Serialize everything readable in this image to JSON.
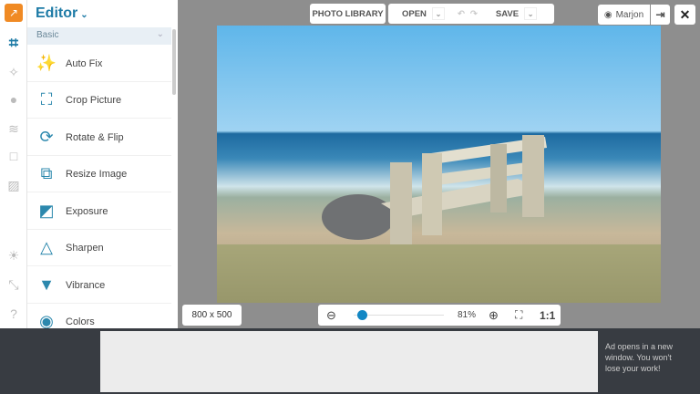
{
  "editor": {
    "title": "Editor",
    "section": "Basic",
    "items": [
      {
        "label": "Auto Fix",
        "icon": "magic-wand-icon"
      },
      {
        "label": "Crop Picture",
        "icon": "crop-picture-icon"
      },
      {
        "label": "Rotate & Flip",
        "icon": "rotate-icon"
      },
      {
        "label": "Resize Image",
        "icon": "resize-icon"
      },
      {
        "label": "Exposure",
        "icon": "exposure-icon"
      },
      {
        "label": "Sharpen",
        "icon": "triangle-icon"
      },
      {
        "label": "Vibrance",
        "icon": "vibrance-icon"
      },
      {
        "label": "Colors",
        "icon": "colors-icon"
      }
    ]
  },
  "toolbar": {
    "photo_library": "PHOTO LIBRARY",
    "open": "OPEN",
    "save": "SAVE",
    "user": "Marjon"
  },
  "canvas": {
    "dimensions": "800 x 500",
    "zoom": "81%",
    "zoom_slider_fraction": 0.1,
    "one_to_one": "1:1"
  },
  "ad": {
    "notice": "Ad opens in a new window. You won't lose your work!"
  },
  "colors": {
    "accent": "#1e7ba6",
    "slider": "#1287c4"
  }
}
